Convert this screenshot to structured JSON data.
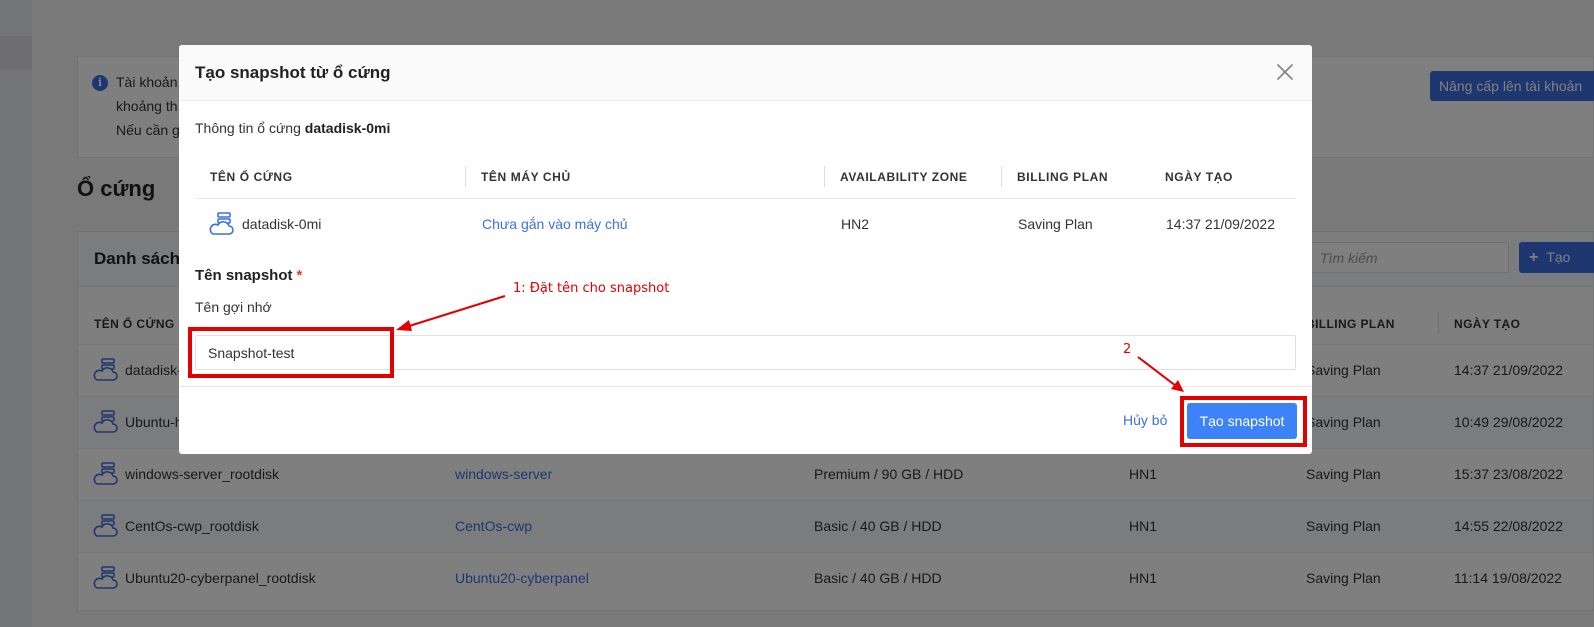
{
  "background": {
    "info_lines": [
      "Tài khoản",
      "khoảng th",
      "Nếu cần g"
    ],
    "upgrade_button": "Nâng cấp lên tài khoản",
    "page_title": "Ổ cứng",
    "list_title": "Danh sách",
    "search_placeholder": "Tìm kiếm",
    "create_button": "Tạo",
    "columns": {
      "name": "TÊN Ổ CỨNG",
      "billing": "BILLING PLAN",
      "created": "NGÀY TẠO"
    },
    "rows": [
      {
        "name": "datadisk-",
        "server": "",
        "spec": "",
        "zone": "",
        "billing": "Saving Plan",
        "created": "14:37 21/09/2022"
      },
      {
        "name": "Ubuntu-h",
        "server": "",
        "spec": "",
        "zone": "",
        "billing": "Saving Plan",
        "created": "10:49 29/08/2022"
      },
      {
        "name": "windows-server_rootdisk",
        "server": "windows-server",
        "spec": "Premium / 90 GB / HDD",
        "zone": "HN1",
        "billing": "Saving Plan",
        "created": "15:37 23/08/2022"
      },
      {
        "name": "CentOs-cwp_rootdisk",
        "server": "CentOs-cwp",
        "spec": "Basic / 40 GB / HDD",
        "zone": "HN1",
        "billing": "Saving Plan",
        "created": "14:55 22/08/2022"
      },
      {
        "name": "Ubuntu20-cyberpanel_rootdisk",
        "server": "Ubuntu20-cyberpanel",
        "spec": "Basic / 40 GB / HDD",
        "zone": "HN1",
        "billing": "Saving Plan",
        "created": "11:14 19/08/2022"
      }
    ]
  },
  "modal": {
    "title": "Tạo snapshot từ ổ cứng",
    "disk_info_prefix": "Thông tin ổ cứng",
    "disk_name": "datadisk-0mi",
    "columns": {
      "disk_name": "TÊN Ổ CỨNG",
      "server_name": "TÊN MÁY CHỦ",
      "zone": "AVAILABILITY ZONE",
      "billing": "BILLING PLAN",
      "created": "NGÀY TẠO"
    },
    "row": {
      "disk_name": "datadisk-0mi",
      "server": "Chưa gắn vào máy chủ",
      "zone": "HN2",
      "billing": "Saving Plan",
      "created": "14:37 21/09/2022"
    },
    "snapshot_label": "Tên snapshot",
    "required_mark": "*",
    "hint": "Tên gợi nhớ",
    "snapshot_value": "Snapshot-test",
    "cancel_button": "Hủy bỏ",
    "submit_button": "Tạo snapshot"
  },
  "annotations": {
    "step1": "1: Đặt tên cho snapshot",
    "step2": "2",
    "color": "#e30000"
  },
  "colors": {
    "accent": "#3d6fe0",
    "button": "#3d82f7"
  }
}
